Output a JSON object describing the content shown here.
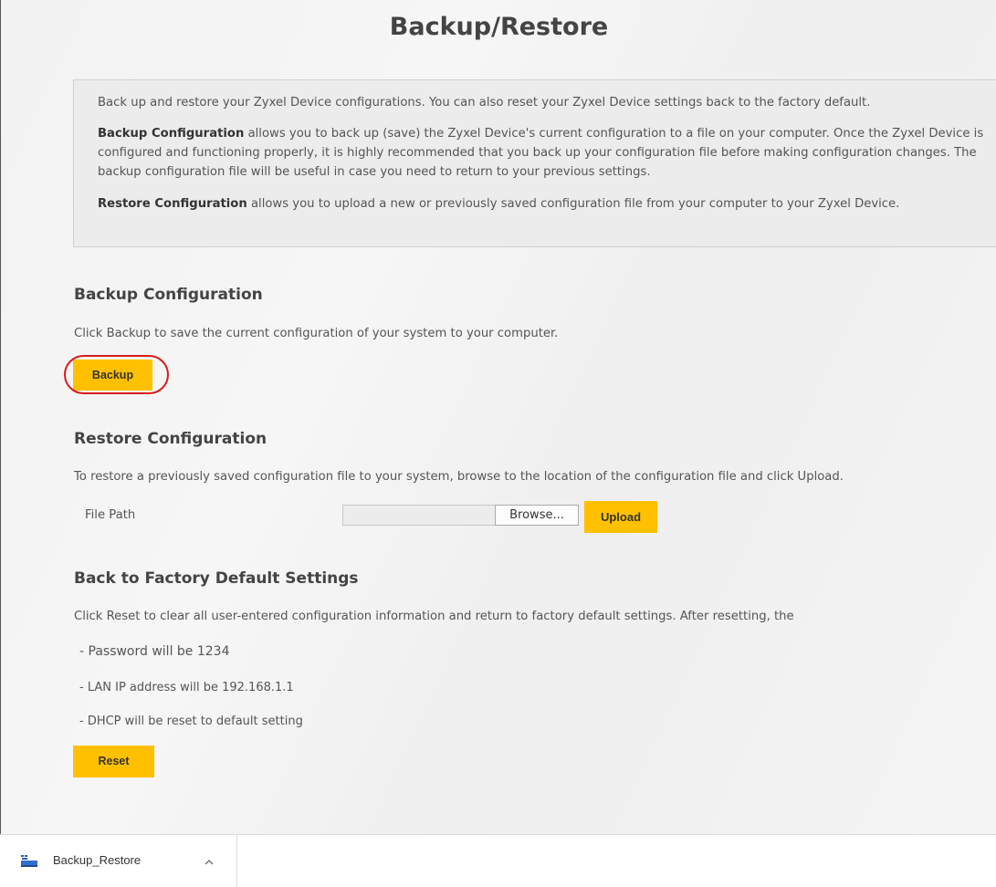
{
  "page": {
    "title": "Backup/Restore"
  },
  "intro": {
    "lead": "Back up and restore your Zyxel Device configurations. You can also reset your Zyxel Device settings back to the factory default.",
    "backup_term": "Backup Configuration",
    "backup_text": " allows you to back up (save) the Zyxel Device's current configuration to a file on your computer. Once the Zyxel Device is configured and functioning properly, it is highly recommended that you back up your configuration file before making configuration changes. The backup configuration file will be useful in case you need to return to your previous settings.",
    "restore_term": "Restore Configuration",
    "restore_text": " allows you to upload a new or previously saved configuration file from your computer to your Zyxel Device."
  },
  "backup": {
    "title": "Backup Configuration",
    "description": "Click Backup to save the current configuration of your system to your computer.",
    "button_label": "Backup"
  },
  "restore": {
    "title": "Restore Configuration",
    "description": "To restore a previously saved configuration file to your system, browse to the location of the configuration file and click Upload.",
    "file_path_label": "File Path",
    "file_path_value": "",
    "browse_label": "Browse...",
    "upload_label": "Upload"
  },
  "factory": {
    "title": "Back to Factory Default Settings",
    "description": "Click Reset to clear all user-entered configuration information and return to factory default settings. After resetting, the",
    "items": [
      "- Password will be 1234",
      "- LAN IP address will be 192.168.1.1",
      "- DHCP will be reset to default setting"
    ],
    "reset_label": "Reset"
  },
  "download_bar": {
    "file_name": "Backup_Restore",
    "icon": "file-download-icon",
    "toggle_icon": "chevron-up-icon"
  },
  "colors": {
    "accent": "#ffc000",
    "highlight": "#d81b1b"
  }
}
